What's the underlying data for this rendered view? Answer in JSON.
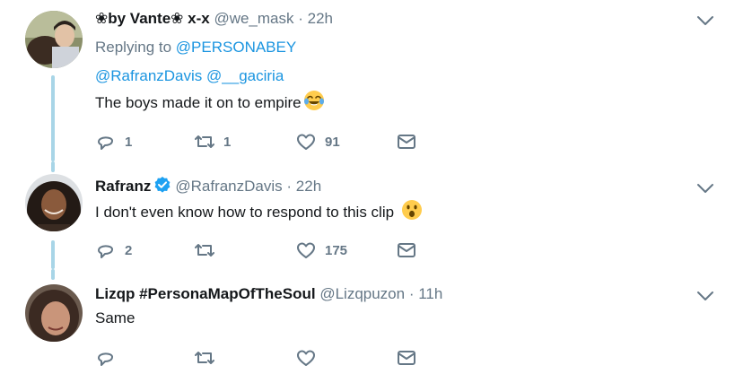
{
  "tweets": [
    {
      "display_name": "❀by Vante❀ x-x",
      "handle": "@we_mask",
      "separator": "·",
      "time": "22h",
      "replying_prefix": "Replying to",
      "replying_to": "@PERSONABEY",
      "mention_1": "@RafranzDavis",
      "mention_2": "@__gaciria",
      "text": "The boys made it on to empire",
      "emoji": "face-with-tears-of-joy",
      "replies": "1",
      "retweets": "1",
      "likes": "91"
    },
    {
      "display_name": "Rafranz",
      "verified": true,
      "handle": "@RafranzDavis",
      "separator": "·",
      "time": "22h",
      "text": "I don't even know how to respond to this clip",
      "emoji": "face-with-open-mouth",
      "replies": "2",
      "retweets": "",
      "likes": "175"
    },
    {
      "display_name": "Lizqp #PersonaMapOfTheSoul",
      "handle": "@Lizqpuzon",
      "separator": "·",
      "time": "11h",
      "text": "Same",
      "replies": "",
      "retweets": "",
      "likes": ""
    }
  ],
  "colors": {
    "thread_line": "#a8d5e7",
    "link": "#1b95e0",
    "muted": "#657786",
    "verified": "#1da1f2"
  }
}
